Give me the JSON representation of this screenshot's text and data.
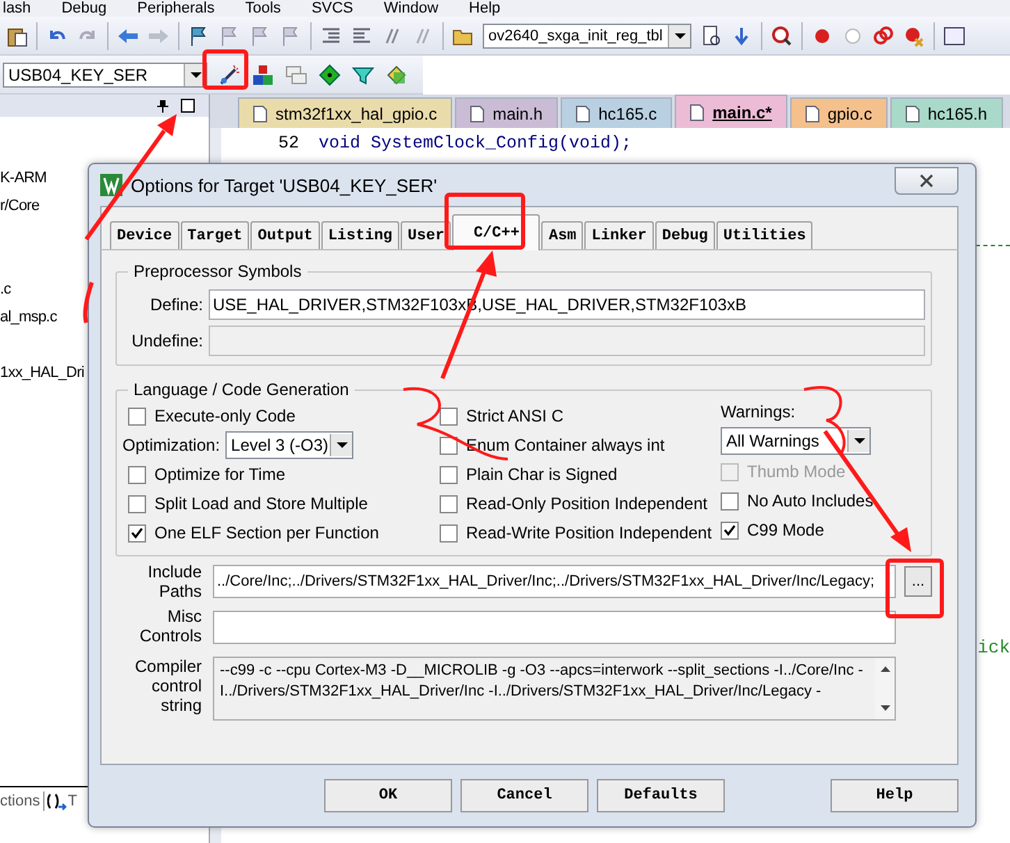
{
  "menu_bar": [
    "lash",
    "Debug",
    "Peripherals",
    "Tools",
    "SVCS",
    "Window",
    "Help"
  ],
  "toolbar": {
    "find_dropdown": "ov2640_sxga_init_reg_tbl"
  },
  "build_toolbar": {
    "target_dropdown": "USB04_KEY_SER"
  },
  "project_panel": {
    "items": [
      "K-ARM",
      "r/Core",
      ".c",
      "al_msp.c",
      "1xx_HAL_Dri"
    ],
    "bottom_tabs": [
      "ctions",
      "T"
    ]
  },
  "editor_tabs": [
    {
      "label": "stm32f1xx_hal_gpio.c",
      "selected": false,
      "color": "#eadcaa"
    },
    {
      "label": "main.h",
      "selected": false,
      "color": "#cbbcd6"
    },
    {
      "label": "hc165.c",
      "selected": false,
      "color": "#b8d0e2"
    },
    {
      "label": "main.c*",
      "selected": true,
      "color": "#ecbcd6"
    },
    {
      "label": "gpio.c",
      "selected": false,
      "color": "#f4c08c"
    },
    {
      "label": "hc165.h",
      "selected": false,
      "color": "#a9d9c8"
    }
  ],
  "editor": {
    "lines": [
      {
        "number": "52",
        "code": "void SystemClock_Config(void);"
      }
    ],
    "fragment": "ick"
  },
  "dialog": {
    "title": "Options for Target 'USB04_KEY_SER'",
    "tabs": [
      {
        "label": "Device",
        "selected": false
      },
      {
        "label": "Target",
        "selected": false
      },
      {
        "label": "Output",
        "selected": false
      },
      {
        "label": "Listing",
        "selected": false
      },
      {
        "label": "User",
        "selected": false
      },
      {
        "label": "C/C++",
        "selected": true
      },
      {
        "label": "Asm",
        "selected": false
      },
      {
        "label": "Linker",
        "selected": false
      },
      {
        "label": "Debug",
        "selected": false
      },
      {
        "label": "Utilities",
        "selected": false
      }
    ],
    "preprocessor": {
      "title": "Preprocessor Symbols",
      "fields": [
        {
          "label": "Define:",
          "value": "USE_HAL_DRIVER,STM32F103xB,USE_HAL_DRIVER,STM32F103xB",
          "disabled": false
        },
        {
          "label": "Undefine:",
          "disabled": true
        }
      ]
    },
    "code_generation": {
      "title": "Language / Code Generation",
      "columns": [
        [
          {
            "kind": "checkbox",
            "label": "Execute-only Code",
            "checked": false,
            "disabled": false
          },
          {
            "kind": "dropdown",
            "label": "Optimization:",
            "value": "Level 3 (-O3)"
          },
          {
            "kind": "checkbox",
            "label": "Optimize for Time",
            "checked": false,
            "disabled": false
          },
          {
            "kind": "checkbox",
            "label": "Split Load and Store Multiple",
            "checked": false,
            "disabled": false
          },
          {
            "kind": "checkbox",
            "label": "One ELF Section per Function",
            "checked": true,
            "disabled": false
          }
        ],
        [
          {
            "kind": "checkbox",
            "label": "Strict ANSI C",
            "checked": false,
            "disabled": false
          },
          {
            "kind": "checkbox",
            "label": "Enum Container always int",
            "checked": false,
            "disabled": false
          },
          {
            "kind": "checkbox",
            "label": "Plain Char is Signed",
            "checked": false,
            "disabled": false
          },
          {
            "kind": "checkbox",
            "label": "Read-Only Position Independent",
            "checked": false,
            "disabled": false
          },
          {
            "kind": "checkbox",
            "label": "Read-Write Position Independent",
            "checked": false,
            "disabled": false
          }
        ],
        [
          {
            "kind": "stacked_dropdown",
            "label": "Warnings:",
            "value": "All Warnings"
          },
          {
            "kind": "checkbox",
            "label": "Thumb Mode",
            "checked": false,
            "disabled": true
          },
          {
            "kind": "checkbox",
            "label": "No Auto Includes",
            "checked": false,
            "disabled": false
          },
          {
            "kind": "checkbox",
            "label": "C99 Mode",
            "checked": true,
            "disabled": false
          }
        ]
      ]
    },
    "include_paths": {
      "label": "Include Paths",
      "value": "../Core/Inc;../Drivers/STM32F1xx_HAL_Driver/Inc;../Drivers/STM32F1xx_HAL_Driver/Inc/Legacy;",
      "browse": "..."
    },
    "misc_controls": {
      "label": "Misc Controls"
    },
    "compiler_string": {
      "label": "Compiler control string",
      "value": "--c99 -c --cpu Cortex-M3 -D__MICROLIB -g -O3 --apcs=interwork --split_sections -I../Core/Inc -I../Drivers/STM32F1xx_HAL_Driver/Inc -I../Drivers/STM32F1xx_HAL_Driver/Inc/Legacy -"
    },
    "buttons": [
      "OK",
      "Cancel",
      "Defaults",
      "Help"
    ]
  }
}
